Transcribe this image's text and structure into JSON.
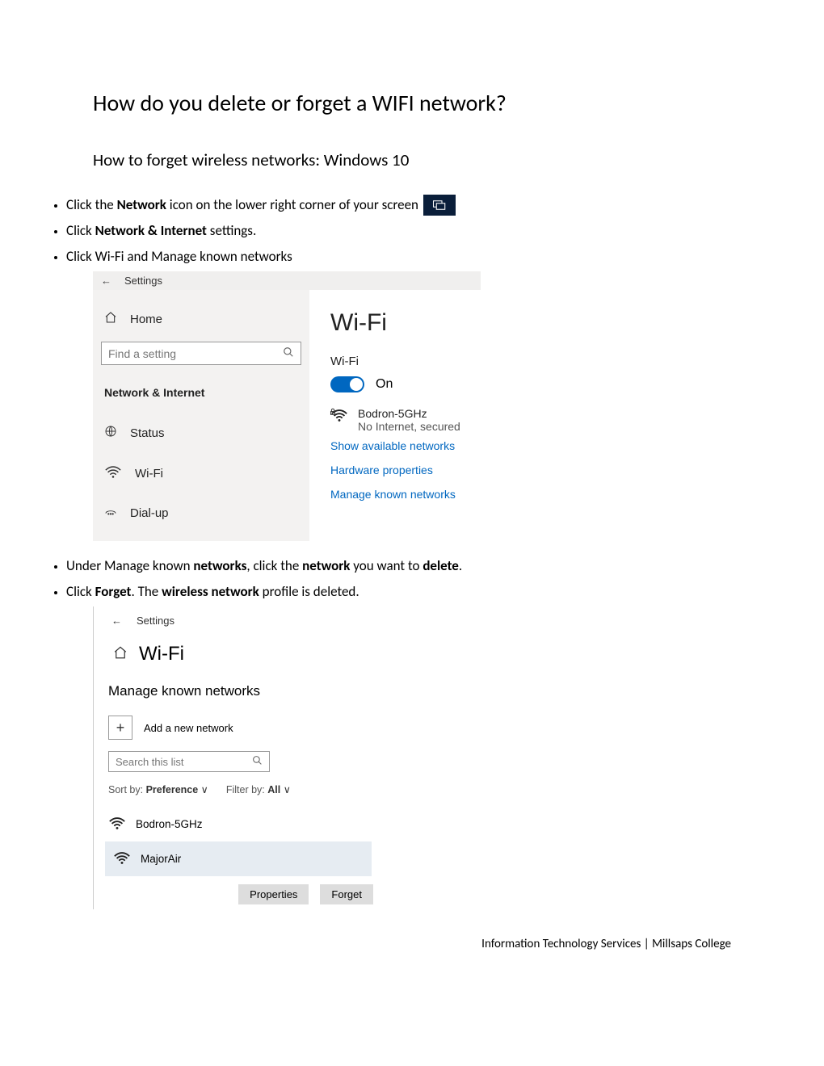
{
  "doc": {
    "title": "How do you delete or forget a WIFI network?",
    "subtitle": "How to forget wireless networks: Windows 10",
    "steps": {
      "s1a": "Click the ",
      "s1b": "Network",
      "s1c": " icon on the lower right corner of your screen",
      "s2a": "Click ",
      "s2b": "Network & Internet",
      "s2c": " settings.",
      "s3": "Click Wi-Fi and Manage known networks",
      "s4a": "Under Manage known ",
      "s4b": "networks",
      "s4c": ", click the ",
      "s4d": "network",
      "s4e": " you want to ",
      "s4f": "delete",
      "s4g": ".",
      "s5a": "Click ",
      "s5b": "Forget",
      "s5c": ". The ",
      "s5d": "wireless network",
      "s5e": " profile is deleted."
    },
    "footer": "Information Technology Services | Millsaps College"
  },
  "shot1": {
    "back": "←",
    "appname": "Settings",
    "home": "Home",
    "search_placeholder": "Find a setting",
    "category": "Network & Internet",
    "nav": {
      "status": "Status",
      "wifi": "Wi-Fi",
      "dialup": "Dial-up"
    },
    "right": {
      "heading": "Wi-Fi",
      "wifi_label": "Wi-Fi",
      "toggle_state": "On",
      "network_name": "Bodron-5GHz",
      "network_status": "No Internet, secured",
      "link_available": "Show available networks",
      "link_hw": "Hardware properties",
      "link_manage": "Manage known networks"
    }
  },
  "shot2": {
    "back": "←",
    "appname": "Settings",
    "title": "Wi-Fi",
    "heading": "Manage known networks",
    "add_label": "Add a new network",
    "search_placeholder": "Search this list",
    "sort_label": "Sort by:",
    "sort_value": "Preference",
    "filter_label": "Filter by:",
    "filter_value": "All",
    "nets": {
      "n1": "Bodron-5GHz",
      "n2": "MajorAir"
    },
    "btn_props": "Properties",
    "btn_forget": "Forget"
  }
}
